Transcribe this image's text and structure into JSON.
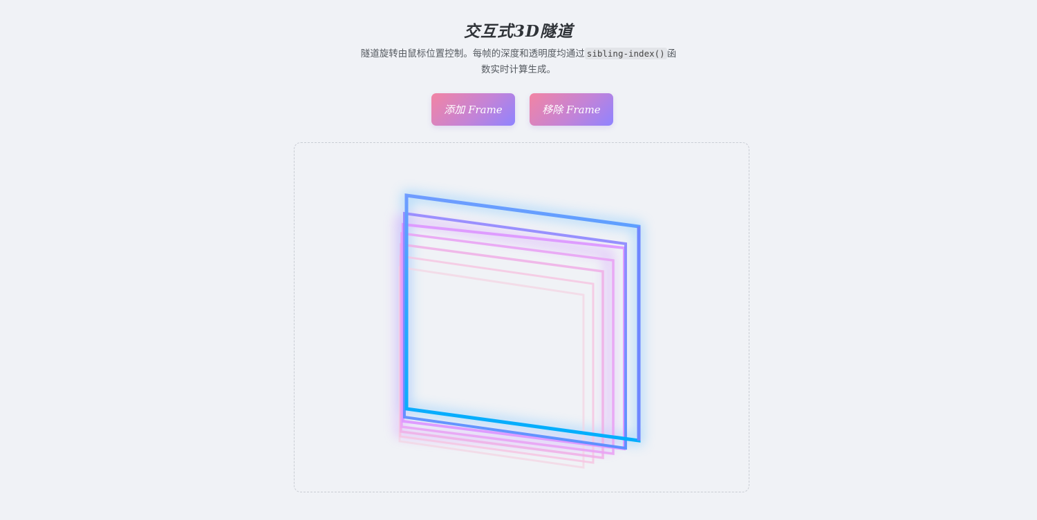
{
  "page": {
    "title": "交互式3D隧道",
    "description_pre": "隧道旋转由鼠标位置控制。每帧的深度和透明度均通过",
    "description_code": "sibling-index()",
    "description_post": "函数实时计算生成。"
  },
  "controls": {
    "add_label": "添加 Frame",
    "remove_label": "移除 Frame"
  },
  "tunnel": {
    "frame_count": 7,
    "colors": {
      "front": "#00b2ff",
      "front_top": "#6aa0ff",
      "mid": "#b888ff",
      "pink": "#ee9ae8",
      "back": "#f4c8e6"
    }
  }
}
